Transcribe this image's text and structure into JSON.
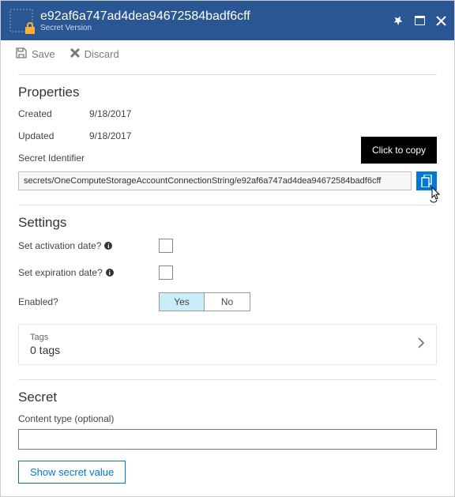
{
  "header": {
    "title": "e92af6a747ad4dea94672584badf6cff",
    "subtitle": "Secret Version"
  },
  "toolbar": {
    "save_label": "Save",
    "discard_label": "Discard"
  },
  "properties": {
    "heading": "Properties",
    "created_label": "Created",
    "created_value": "9/18/2017",
    "updated_label": "Updated",
    "updated_value": "9/18/2017",
    "identifier_label": "Secret Identifier",
    "identifier_value": "secrets/OneComputeStorageAccountConnectionString/e92af6a747ad4dea94672584badf6cff",
    "copy_tooltip": "Click to copy"
  },
  "settings": {
    "heading": "Settings",
    "activation_label": "Set activation date?",
    "expiration_label": "Set expiration date?",
    "enabled_label": "Enabled?",
    "enabled_yes": "Yes",
    "enabled_no": "No"
  },
  "tags": {
    "label": "Tags",
    "count": "0 tags"
  },
  "secret": {
    "heading": "Secret",
    "content_type_label": "Content type (optional)",
    "content_type_value": "",
    "show_button": "Show secret value"
  }
}
